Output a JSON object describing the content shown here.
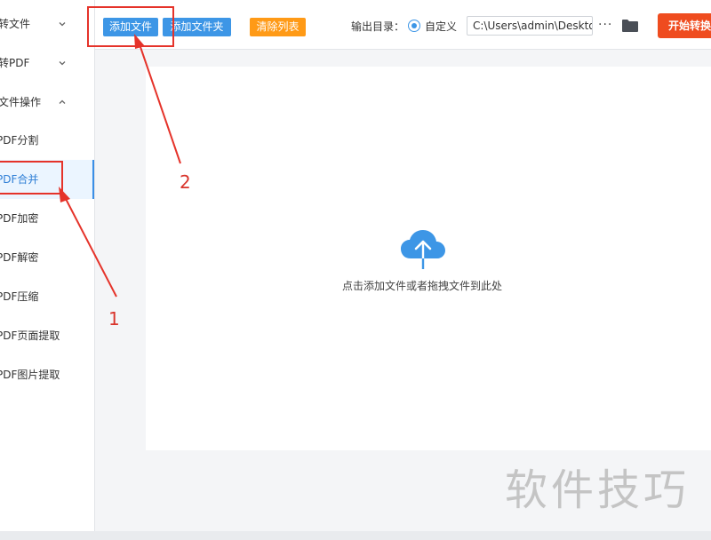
{
  "sidebar": {
    "groups": [
      {
        "label": "转文件",
        "expanded": false
      },
      {
        "label": "转PDF",
        "expanded": false
      },
      {
        "label": "文件操作",
        "expanded": true
      }
    ],
    "items": [
      {
        "label": "PDF分割"
      },
      {
        "label": "PDF合并",
        "active": true
      },
      {
        "label": "PDF加密"
      },
      {
        "label": "PDF解密"
      },
      {
        "label": "PDF压缩"
      },
      {
        "label": "PDF页面提取"
      },
      {
        "label": "PDF图片提取"
      }
    ]
  },
  "toolbar": {
    "add_file": "添加文件",
    "add_folder": "添加文件夹",
    "clear_list": "清除列表",
    "output_label": "输出目录：",
    "output_option": "自定义",
    "output_path": "C:\\Users\\admin\\Deskto",
    "more": "···",
    "start": "开始转换"
  },
  "dropzone": {
    "hint": "点击添加文件或者拖拽文件到此处",
    "icon": "cloud-upload-icon"
  },
  "annotations": {
    "label_1": "1",
    "label_2": "2"
  },
  "watermark": "软件技巧",
  "colors": {
    "primary": "#3d96e6",
    "orange": "#ff9a16",
    "start": "#ef4c1f",
    "annotation": "#e5332a"
  }
}
